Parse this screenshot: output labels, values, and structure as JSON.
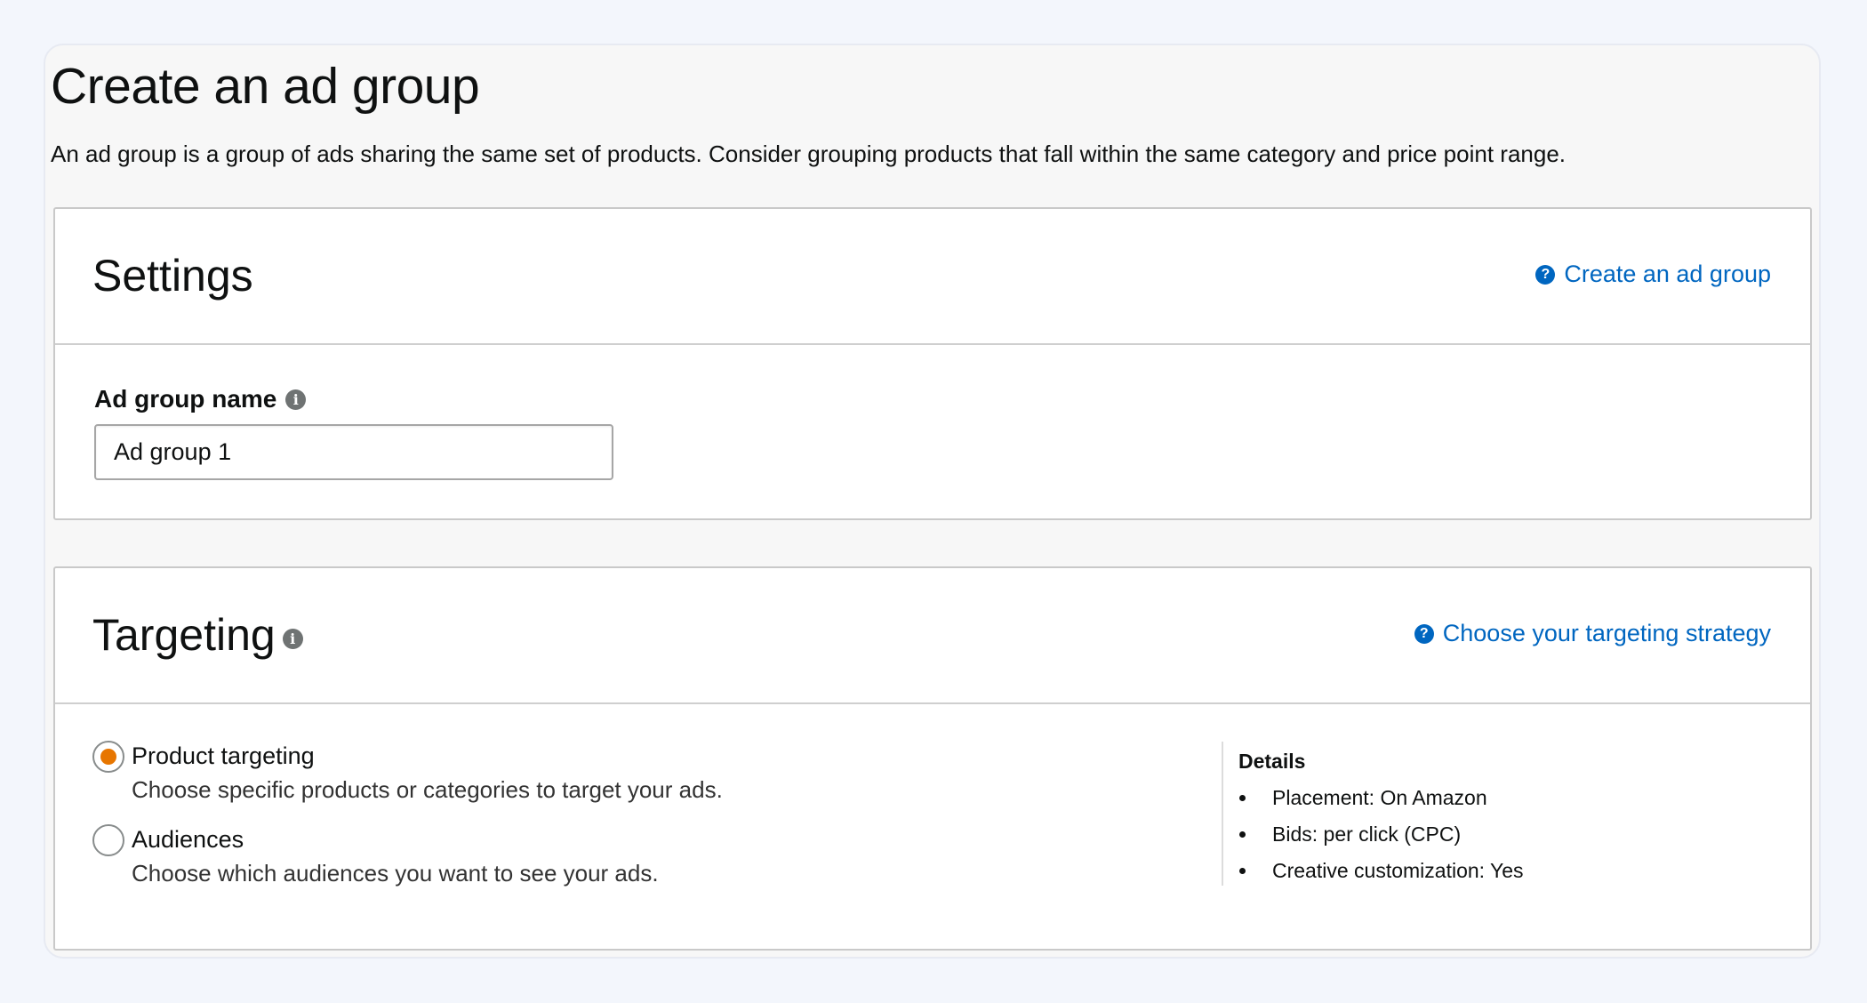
{
  "page": {
    "title": "Create an ad group",
    "description": "An ad group is a group of ads sharing the same set of products. Consider grouping products that fall within the same category and price point range."
  },
  "settings": {
    "title": "Settings",
    "help_link": "Create an ad group",
    "ad_group_name_label": "Ad group name",
    "ad_group_name_value": "Ad group 1"
  },
  "targeting": {
    "title": "Targeting",
    "help_link": "Choose your targeting strategy",
    "options": [
      {
        "label": "Product targeting",
        "description": "Choose specific products or categories to target your ads.",
        "selected": true
      },
      {
        "label": "Audiences",
        "description": "Choose which audiences you want to see your ads.",
        "selected": false
      }
    ],
    "details": {
      "title": "Details",
      "items": [
        "Placement: On Amazon",
        "Bids: per click (CPC)",
        "Creative customization: Yes"
      ]
    }
  },
  "icons": {
    "info": "info-icon",
    "help": "help-circle-icon"
  },
  "colors": {
    "link": "#0066c0",
    "radio_selected": "#e77600",
    "background": "#f3f6fc"
  }
}
